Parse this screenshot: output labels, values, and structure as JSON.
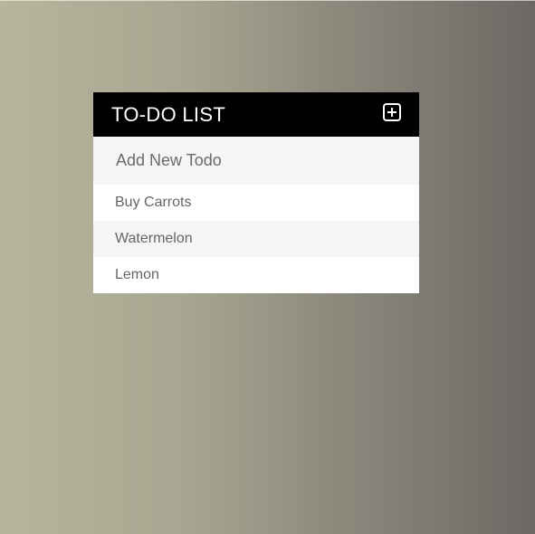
{
  "header": {
    "title": "TO-DO LIST",
    "add_icon": "plus-square-icon"
  },
  "new_todo": {
    "placeholder": "Add New Todo",
    "value": ""
  },
  "todos": [
    {
      "text": "Buy Carrots"
    },
    {
      "text": "Watermelon"
    },
    {
      "text": "Lemon"
    }
  ],
  "colors": {
    "header_bg": "#000000",
    "header_text": "#ffffff",
    "row_alt_bg": "#f5f5f5",
    "item_text": "#666666"
  }
}
